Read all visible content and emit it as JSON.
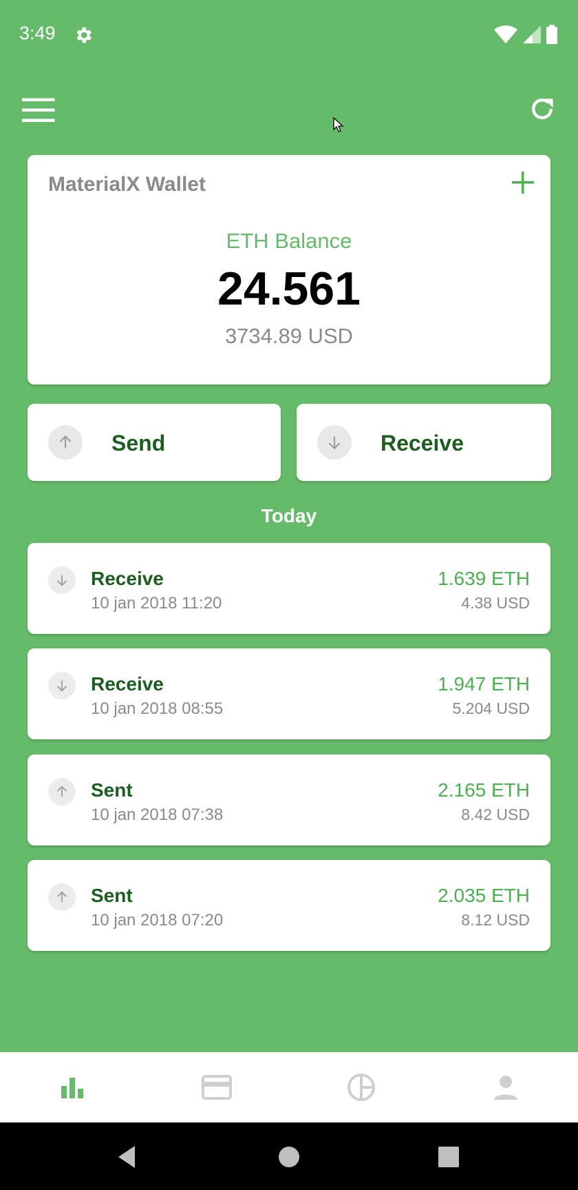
{
  "status": {
    "time": "3:49"
  },
  "wallet": {
    "title": "MaterialX Wallet",
    "balance_label": "ETH Balance",
    "balance_value": "24.561",
    "balance_usd": "3734.89 USD"
  },
  "actions": {
    "send_label": "Send",
    "receive_label": "Receive"
  },
  "section_title": "Today",
  "transactions": [
    {
      "type": "Receive",
      "date": "10 jan 2018 11:20",
      "eth": "1.639 ETH",
      "usd": "4.38 USD"
    },
    {
      "type": "Receive",
      "date": "10 jan 2018 08:55",
      "eth": "1.947 ETH",
      "usd": "5.204 USD"
    },
    {
      "type": "Sent",
      "date": "10 jan 2018 07:38",
      "eth": "2.165 ETH",
      "usd": "8.42 USD"
    },
    {
      "type": "Sent",
      "date": "10 jan 2018 07:20",
      "eth": "2.035 ETH",
      "usd": "8.12 USD"
    }
  ],
  "bottom_nav": [
    "bar-chart-icon",
    "card-icon",
    "pie-chart-icon",
    "person-icon"
  ],
  "colors": {
    "primary": "#66bb6a",
    "dark_green": "#1b5e20",
    "accent": "#4caf50"
  }
}
